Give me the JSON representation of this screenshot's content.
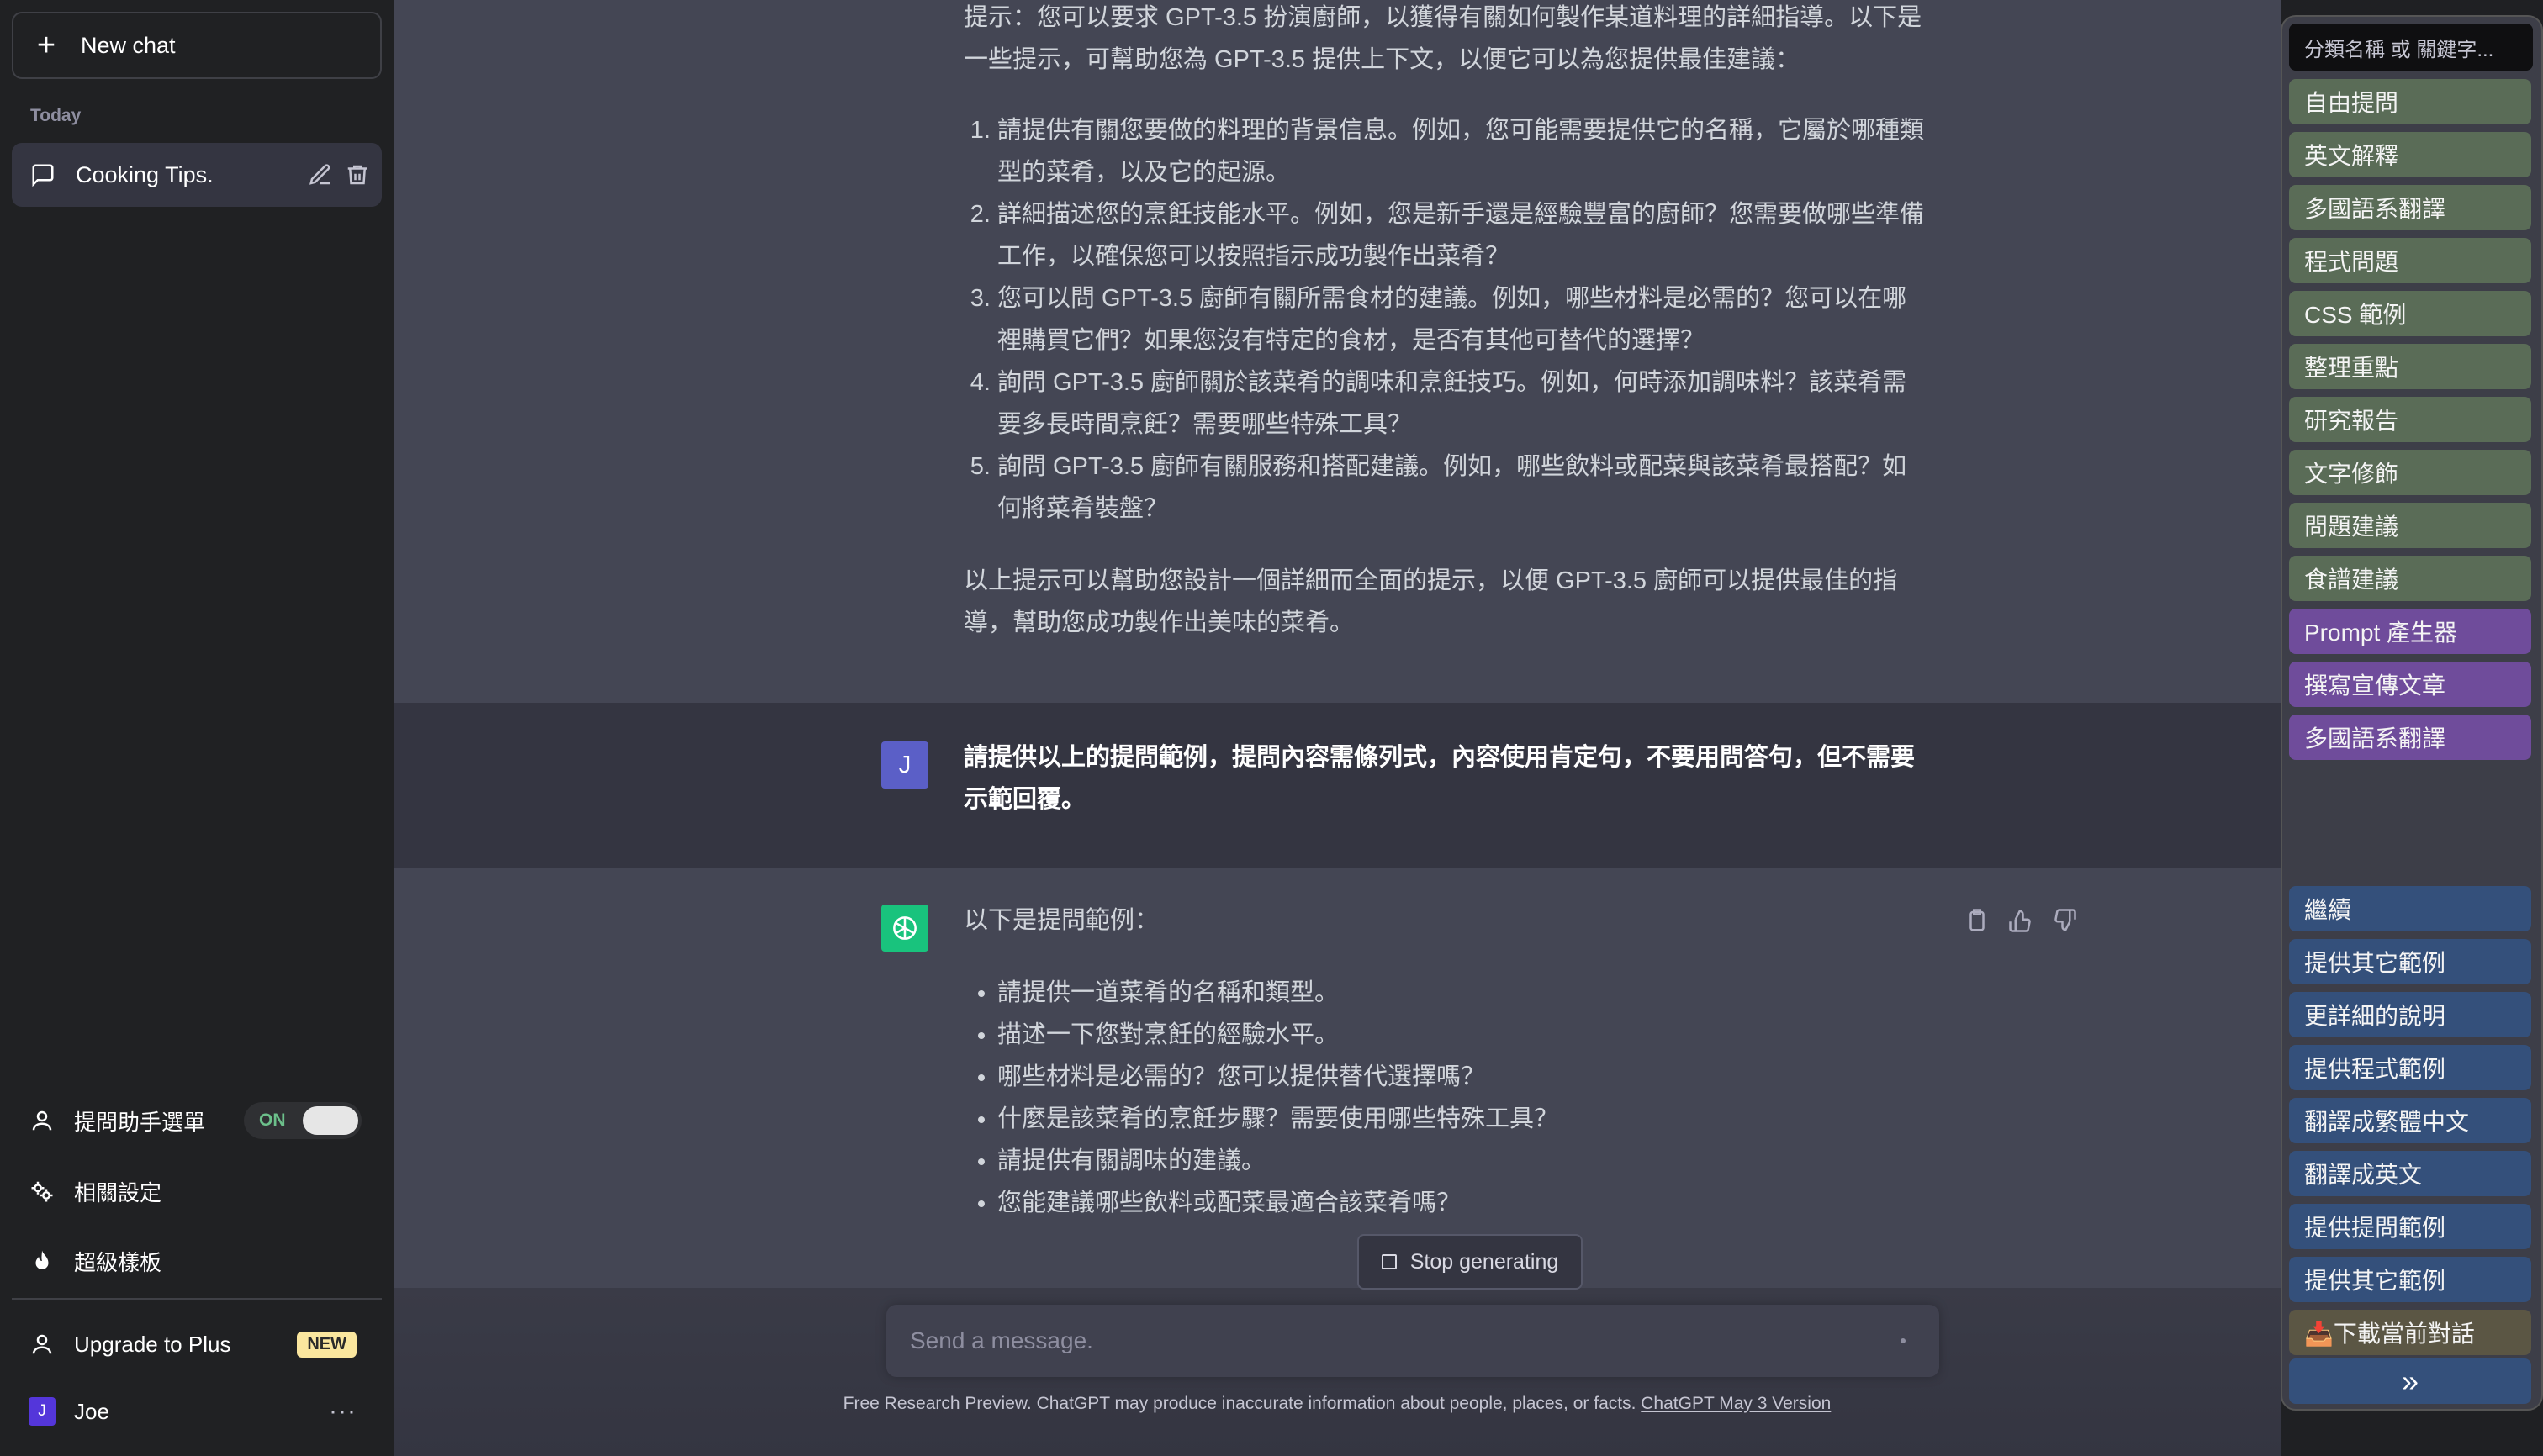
{
  "sidebar": {
    "new_chat_label": "New chat",
    "section_today": "Today",
    "chat_item_title": "Cooking Tips.",
    "assistant_menu_label": "提問助手選單",
    "toggle_label": "ON",
    "settings_label": "相關設定",
    "templates_label": "超級樣板",
    "upgrade_label": "Upgrade to Plus",
    "new_badge": "NEW",
    "user_initial": "J",
    "user_name": "Joe",
    "more_dots": "···"
  },
  "conversation": {
    "assistant1": {
      "intro": "提示：您可以要求 GPT-3.5 扮演廚師，以獲得有關如何製作某道料理的詳細指導。以下是一些提示，可幫助您為 GPT-3.5 提供上下文，以便它可以為您提供最佳建議：",
      "items": [
        "請提供有關您要做的料理的背景信息。例如，您可能需要提供它的名稱，它屬於哪種類型的菜肴，以及它的起源。",
        "詳細描述您的烹飪技能水平。例如，您是新手還是經驗豐富的廚師？您需要做哪些準備工作，以確保您可以按照指示成功製作出菜肴？",
        "您可以問 GPT-3.5 廚師有關所需食材的建議。例如，哪些材料是必需的？您可以在哪裡購買它們？如果您沒有特定的食材，是否有其他可替代的選擇？",
        "詢問 GPT-3.5 廚師關於該菜肴的調味和烹飪技巧。例如，何時添加調味料？該菜肴需要多長時間烹飪？需要哪些特殊工具？",
        "詢問 GPT-3.5 廚師有關服務和搭配建議。例如，哪些飲料或配菜與該菜肴最搭配？如何將菜肴裝盤？"
      ],
      "outro": "以上提示可以幫助您設計一個詳細而全面的提示，以便 GPT-3.5 廚師可以提供最佳的指導，幫助您成功製作出美味的菜肴。"
    },
    "user": {
      "initial": "J",
      "text": "請提供以上的提問範例，提問內容需條列式，內容使用肯定句，不要用問答句，但不需要示範回覆。"
    },
    "assistant2": {
      "intro": "以下是提問範例：",
      "bullets": [
        "請提供一道菜肴的名稱和類型。",
        "描述一下您對烹飪的經驗水平。",
        "哪些材料是必需的？您可以提供替代選擇嗎？",
        "什麼是該菜肴的烹飪步驟？需要使用哪些特殊工具？",
        "請提供有關調味的建議。",
        "您能建議哪些飲料或配菜最適合該菜肴嗎？"
      ]
    }
  },
  "composer": {
    "stop_label": "Stop generating",
    "placeholder": "Send a message.",
    "footer_text": "Free Research Preview. ChatGPT may produce inaccurate information about people, places, or facts.",
    "footer_link": "ChatGPT May 3 Version"
  },
  "panel": {
    "search_placeholder": "分類名稱 或 關鍵字...",
    "top_buttons": [
      {
        "label": "自由提問",
        "color": "green"
      },
      {
        "label": "英文解釋",
        "color": "green"
      },
      {
        "label": "多國語系翻譯",
        "color": "green"
      },
      {
        "label": "程式問題",
        "color": "green"
      },
      {
        "label": "CSS 範例",
        "color": "green"
      },
      {
        "label": "整理重點",
        "color": "green"
      },
      {
        "label": "研究報告",
        "color": "green"
      },
      {
        "label": "文字修飾",
        "color": "green"
      },
      {
        "label": "問題建議",
        "color": "green"
      },
      {
        "label": "食譜建議",
        "color": "green"
      },
      {
        "label": "Prompt 產生器",
        "color": "purple"
      },
      {
        "label": "撰寫宣傳文章",
        "color": "purple"
      },
      {
        "label": "多國語系翻譯",
        "color": "purple"
      }
    ],
    "bottom_buttons": [
      {
        "label": "繼續",
        "color": "blue"
      },
      {
        "label": "提供其它範例",
        "color": "blue"
      },
      {
        "label": "更詳細的說明",
        "color": "blue"
      },
      {
        "label": "提供程式範例",
        "color": "blue"
      },
      {
        "label": "翻譯成繁體中文",
        "color": "blue"
      },
      {
        "label": "翻譯成英文",
        "color": "blue"
      },
      {
        "label": "提供提問範例",
        "color": "blue"
      },
      {
        "label": "提供其它範例",
        "color": "blue"
      },
      {
        "label": "📥下載當前對話",
        "color": "tan"
      }
    ],
    "collapse_glyph": "»"
  },
  "colors": {
    "sidebar_bg": "#202123",
    "main_bg": "#343541",
    "assistant_bg": "#444654",
    "user_avatar": "#5436da",
    "gpt_avatar": "#19c37d"
  }
}
